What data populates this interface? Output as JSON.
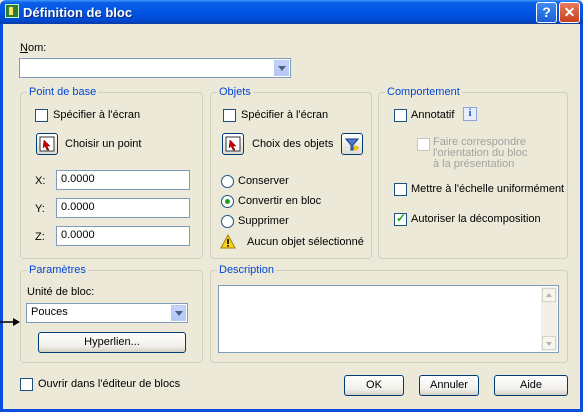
{
  "window": {
    "title": "Définition de bloc"
  },
  "nom": {
    "label": "Nom:",
    "value": ""
  },
  "point_de_base": {
    "title": "Point de base",
    "specify_label": "Spécifier à l'écran",
    "pick_label": "Choisir un point",
    "x_label": "X:",
    "x_value": "0.0000",
    "y_label": "Y:",
    "y_value": "0.0000",
    "z_label": "Z:",
    "z_value": "0.0000"
  },
  "objets": {
    "title": "Objets",
    "specify_label": "Spécifier à l'écran",
    "select_label": "Choix des objets",
    "conserver": "Conserver",
    "convertir": "Convertir en bloc",
    "supprimer": "Supprimer",
    "selected": "convertir",
    "warning": "Aucun objet sélectionné"
  },
  "comportement": {
    "title": "Comportement",
    "annotatif": "Annotatif",
    "orient_line1": "Faire correspondre",
    "orient_line2": "l'orientation du bloc",
    "orient_line3": "à la présentation",
    "echelle": "Mettre à l'échelle uniformément",
    "decomp": "Autoriser la décomposition",
    "decomp_checked": true
  },
  "parametres": {
    "title": "Paramètres",
    "unit_label": "Unité de bloc:",
    "unit_value": "Pouces",
    "hyperlink_label": "Hyperlien..."
  },
  "description": {
    "title": "Description",
    "value": ""
  },
  "footer": {
    "open_editor": "Ouvrir dans l'éditeur de blocs",
    "ok": "OK",
    "cancel": "Annuler",
    "help": "Aide"
  }
}
